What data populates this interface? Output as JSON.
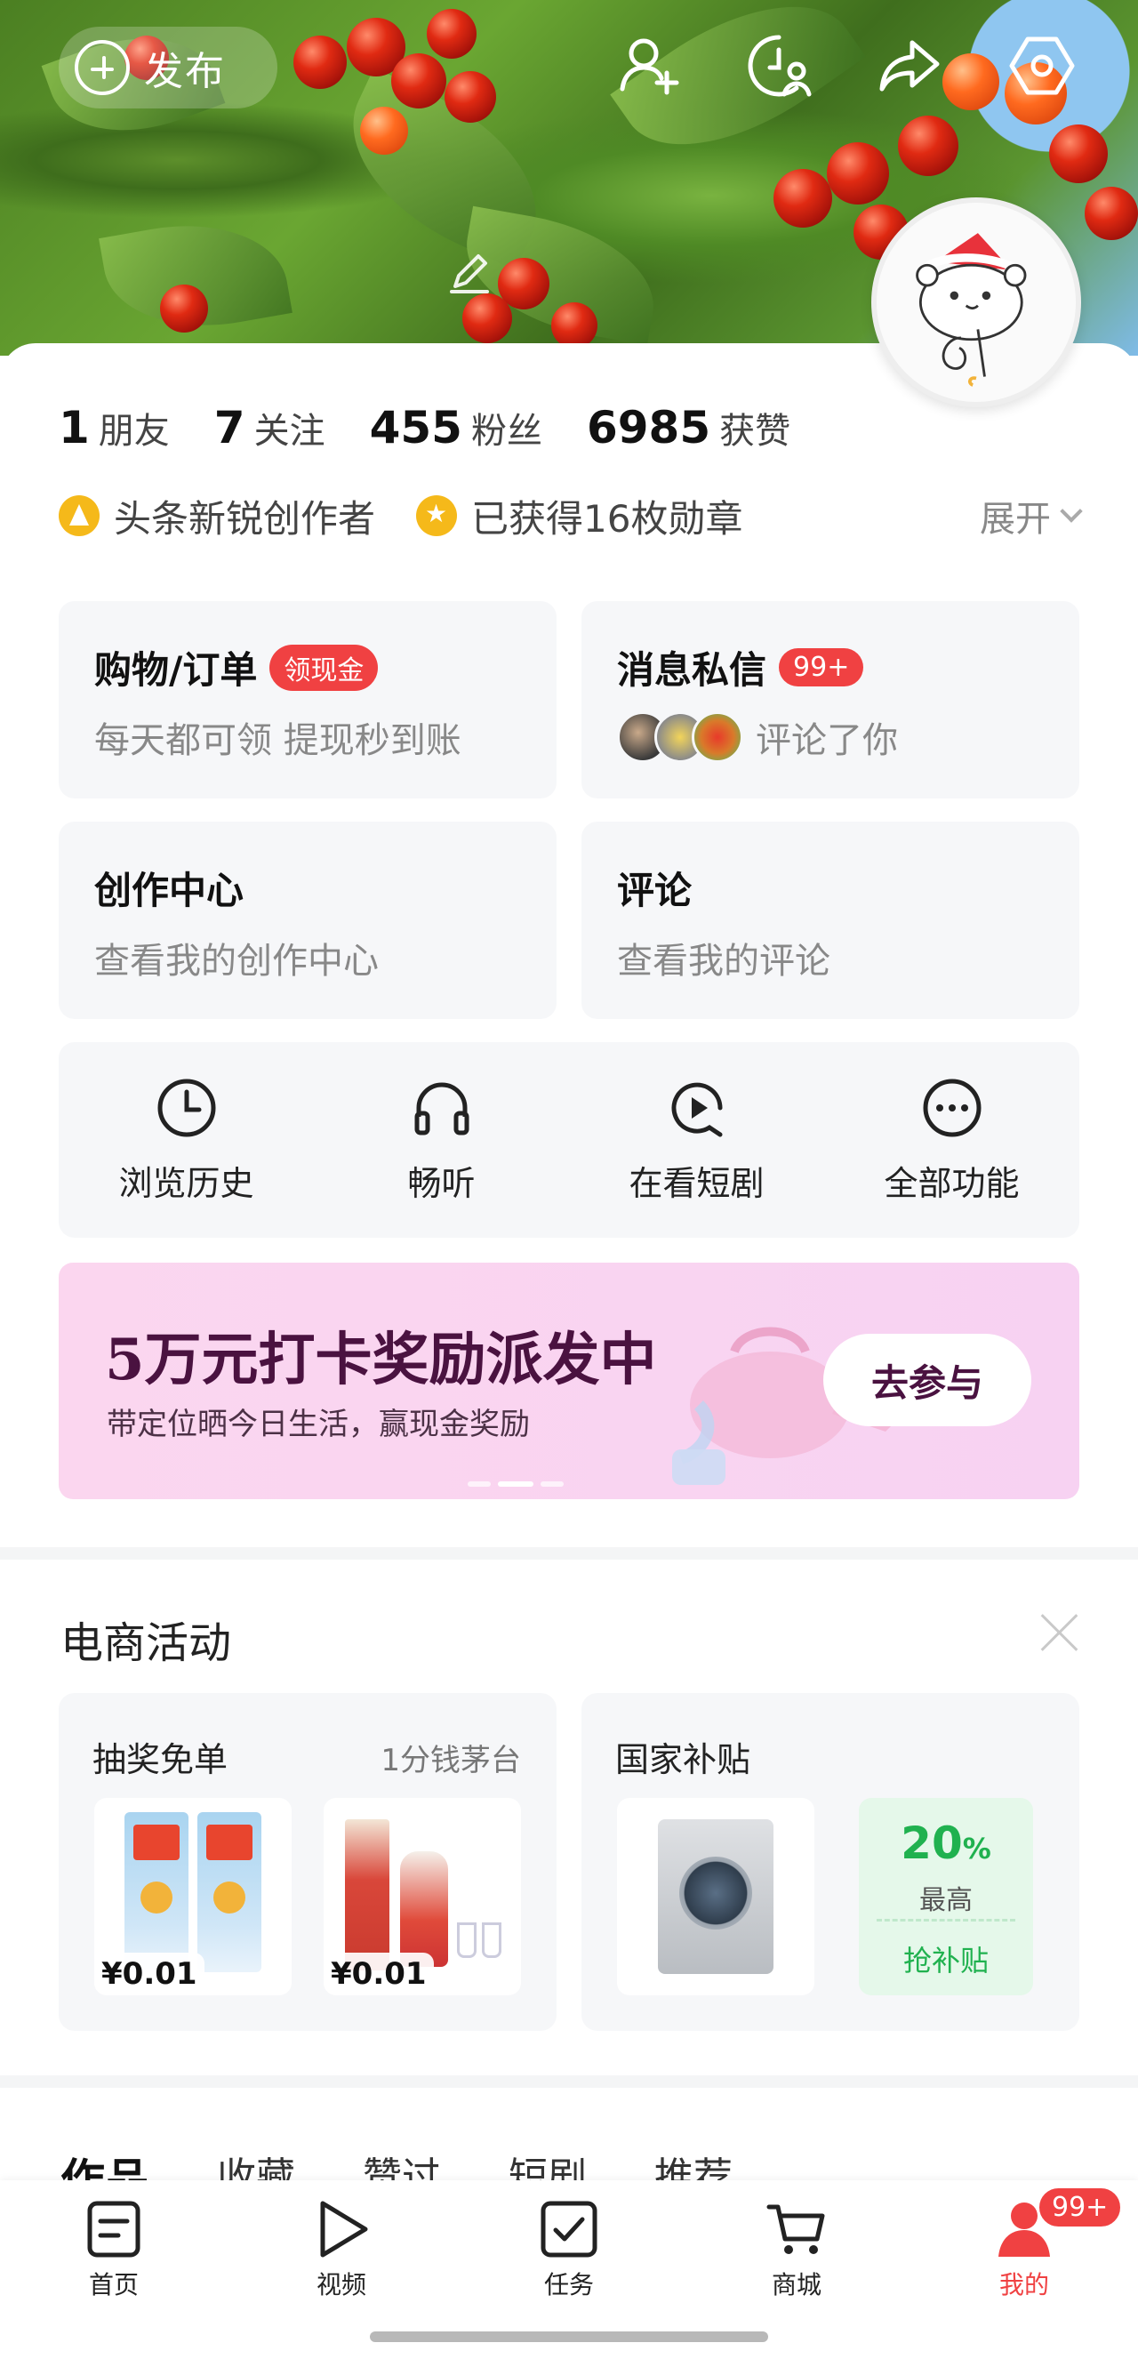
{
  "header": {
    "publish_label": "发布"
  },
  "stats": [
    {
      "value": "1",
      "label": "朋友"
    },
    {
      "value": "7",
      "label": "关注"
    },
    {
      "value": "455",
      "label": "粉丝"
    },
    {
      "value": "6985",
      "label": "获赞"
    }
  ],
  "badges": {
    "creator": "头条新锐创作者",
    "medals": "已获得16枚勋章",
    "expand": "展开"
  },
  "cards": {
    "shopping": {
      "title": "购物/订单",
      "pill": "领现金",
      "sub": "每天都可领 提现秒到账"
    },
    "messages": {
      "title": "消息私信",
      "pill": "99+",
      "sub": "评论了你"
    },
    "creation": {
      "title": "创作中心",
      "sub": "查看我的创作中心"
    },
    "comments": {
      "title": "评论",
      "sub": "查看我的评论"
    }
  },
  "tools": [
    {
      "label": "浏览历史",
      "icon": "clock-icon"
    },
    {
      "label": "畅听",
      "icon": "headphones-icon"
    },
    {
      "label": "在看短剧",
      "icon": "play-circle-icon"
    },
    {
      "label": "全部功能",
      "icon": "more-icon"
    }
  ],
  "banner": {
    "headline": "5万元打卡奖励派发中",
    "sub": "带定位晒今日生活，赢现金奖励",
    "button": "去参与"
  },
  "ecommerce": {
    "title": "电商活动",
    "lottery": {
      "title": "抽奖免单",
      "right": "1分钱茅台",
      "price1": "¥0.01",
      "price2": "¥0.01"
    },
    "subsidy": {
      "title": "国家补贴",
      "pct": "20",
      "pct_unit": "%",
      "max": "最高",
      "grab": "抢补贴"
    }
  },
  "tabs": [
    "作品",
    "收藏",
    "赞过",
    "短剧",
    "推荐"
  ],
  "nav": {
    "home": "首页",
    "video": "视频",
    "task": "任务",
    "mall": "商城",
    "mine": "我的",
    "badge": "99+"
  },
  "colors": {
    "accent": "#f04142",
    "green": "#20b14f",
    "card_bg": "#f6f7f9"
  }
}
